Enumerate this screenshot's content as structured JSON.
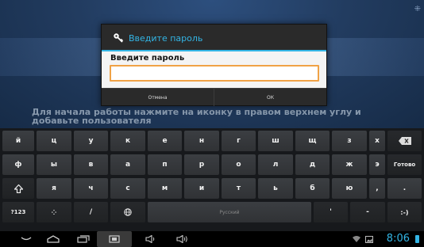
{
  "background": {
    "hint_text": "Для начала работы нажмите на иконку в правом верхнем углу и добавьте пользователя"
  },
  "dialog": {
    "title": "Введите пароль",
    "field_label": "Введите пароль",
    "password_value": "",
    "cancel_label": "Отмена",
    "ok_label": "ОК",
    "accent_color": "#33b5e5"
  },
  "keyboard": {
    "row1": [
      "й",
      "ц",
      "у",
      "к",
      "е",
      "н",
      "г",
      "ш",
      "щ",
      "з",
      "х"
    ],
    "row2": [
      "ф",
      "ы",
      "в",
      "а",
      "п",
      "р",
      "о",
      "л",
      "д",
      "ж",
      "э"
    ],
    "row3": [
      "я",
      "ч",
      "с",
      "м",
      "и",
      "т",
      "ь",
      "б",
      "ю"
    ],
    "row3_extra": [
      ",",
      "."
    ],
    "done_label": "Готово",
    "symbols_label": "?123",
    "slash_label": "/",
    "space_label": "Русский",
    "apostrophe_label": "'",
    "dash_label": "-",
    "smiley_label": ":-)"
  },
  "statusbar": {
    "time": "8:06"
  }
}
